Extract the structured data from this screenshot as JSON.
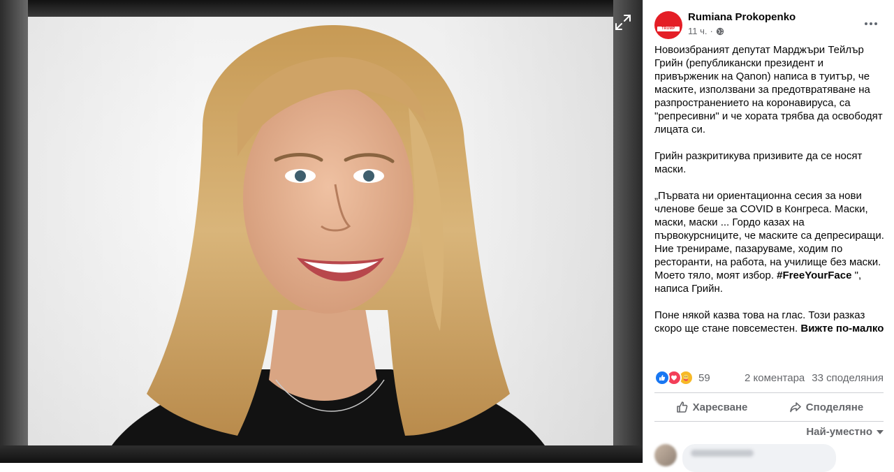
{
  "post": {
    "author": "Rumiana Prokopenko",
    "time": "11 ч.",
    "separator": "·",
    "privacy_icon": "globe-icon",
    "paragraph1": "Новоизбраният депутат Марджъри Тейлър Грийн (републикански президент и привърженик на Qanon) написа в туитър, че маските, използвани за предотвратяване на разпространението на коронавируса, са \"репресивни\" и че хората трябва да освободят лицата си.",
    "paragraph2": "Грийн разкритикува призивите да се носят маски.",
    "paragraph3_before": "„Първата ни ориентационна сесия за нови членове беше за COVID в Конгреса. Маски, маски, маски ... Гордо казах на първокурсниците, че маските са депресиращи. Ние тренираме, пазаруваме, ходим по ресторанти, на работа, на училище без маски. Моето тяло, моят избор. ",
    "hashtag": "#FreeYourFace",
    "paragraph3_after": " \", написа Грийн.",
    "paragraph4": "Поне някой казва това на глас. Този разказ скоро ще стане повсеместен. ",
    "see_more": "Вижте по-малко"
  },
  "stats": {
    "reactions": [
      "like",
      "love",
      "care"
    ],
    "reaction_count": "59",
    "comments": "2 коментара",
    "shares": "33 споделяния"
  },
  "actions": {
    "like_label": "Харесване",
    "share_label": "Споделяне"
  },
  "comments": {
    "sort_label": "Най-уместно"
  },
  "avatar": {
    "logo_text": "TRUMP",
    "color": "#e41e26"
  }
}
